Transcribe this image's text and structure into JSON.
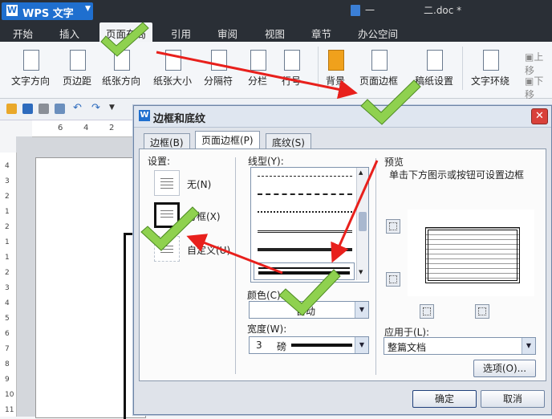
{
  "app": {
    "name": "WPS 文字",
    "logo_letter": "W"
  },
  "doc_tabs": [
    "一",
    "二.doc *"
  ],
  "menu": [
    "开始",
    "插入",
    "页面布局",
    "引用",
    "审阅",
    "视图",
    "章节",
    "办公空间"
  ],
  "ribbon": {
    "items": [
      "文字方向",
      "页边距",
      "纸张方向",
      "纸张大小",
      "分隔符",
      "分栏",
      "行号",
      "背景",
      "页面边框",
      "稿纸设置",
      "文字环绕",
      "上移",
      "下移"
    ]
  },
  "ruler": {
    "ticks": [
      "6",
      "4",
      "2"
    ],
    "vticks": [
      "4",
      "3",
      "2",
      "1",
      "2",
      "1",
      "1",
      "2",
      "3",
      "4",
      "5",
      "6",
      "7",
      "8",
      "9",
      "10",
      "11"
    ]
  },
  "dialog": {
    "logo_letter": "W",
    "title": "边框和底纹",
    "close": "✕",
    "tabs": [
      "边框(B)",
      "页面边框(P)",
      "底纹(S)"
    ],
    "setting_label": "设置:",
    "settings": [
      "无(N)",
      "方框(X)",
      "自定义(U)"
    ],
    "style_label": "线型(Y):",
    "color_label": "颜色(C):",
    "color_value": "自动",
    "width_label": "宽度(W):",
    "width_value": "3",
    "width_unit": "磅",
    "preview_label": "预览",
    "preview_hint": "单击下方图示或按钮可设置边框",
    "apply_label": "应用于(L):",
    "apply_value": "整篇文档",
    "options_button": "选项(O)...",
    "ok_button": "确定",
    "cancel_button": "取消"
  },
  "colors": {
    "accent": "#1f6fcf",
    "annotation_red": "#e8201c",
    "annotation_check": "#8fd14f"
  }
}
